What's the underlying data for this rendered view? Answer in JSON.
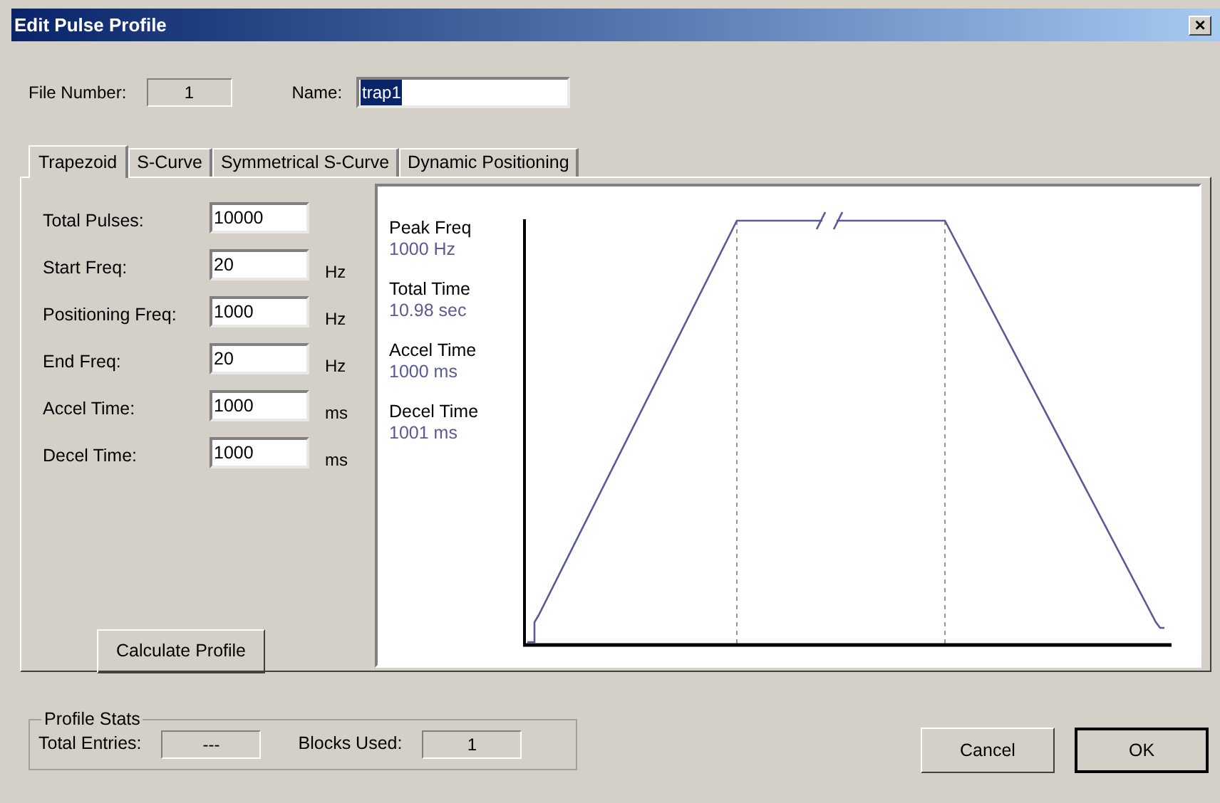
{
  "window": {
    "title": "Edit Pulse Profile",
    "close": "×"
  },
  "file_number": {
    "label": "File Number:",
    "value": "1"
  },
  "name": {
    "label": "Name:",
    "value": "trap1",
    "selected": true
  },
  "tabs": [
    {
      "label": "Trapezoid",
      "selected": true
    },
    {
      "label": "S-Curve",
      "selected": false
    },
    {
      "label": "Symmetrical S-Curve",
      "selected": false
    },
    {
      "label": "Dynamic Positioning",
      "selected": false
    }
  ],
  "parameters": [
    {
      "label": "Total Pulses:",
      "value": "10000"
    },
    {
      "label": "Start Freq:",
      "value": "20",
      "unit": "Hz"
    },
    {
      "label": "Positioning Freq:",
      "value": "1000",
      "unit": "Hz"
    },
    {
      "label": "End Freq:",
      "value": "20",
      "unit": "Hz"
    },
    {
      "label": "Accel Time:",
      "value": "1000",
      "unit": "ms"
    },
    {
      "label": "Decel Time:",
      "value": "1000",
      "unit": "ms"
    }
  ],
  "calculate_button": "Calculate Profile",
  "graph_stats": [
    {
      "label": "Peak Freq",
      "value": "1000 Hz"
    },
    {
      "label": "Total Time",
      "value": "10.98 sec"
    },
    {
      "label": "Accel Time",
      "value": "1000 ms"
    },
    {
      "label": "Decel Time",
      "value": "1001 ms"
    }
  ],
  "profile_stats": {
    "title": "Profile Stats",
    "fields": [
      {
        "label": "Total Entries:",
        "value": "---"
      },
      {
        "label": "Blocks Used:",
        "value": "1"
      }
    ]
  },
  "buttons": [
    {
      "label": "Cancel",
      "default": false
    },
    {
      "label": "OK",
      "default": true
    }
  ]
}
